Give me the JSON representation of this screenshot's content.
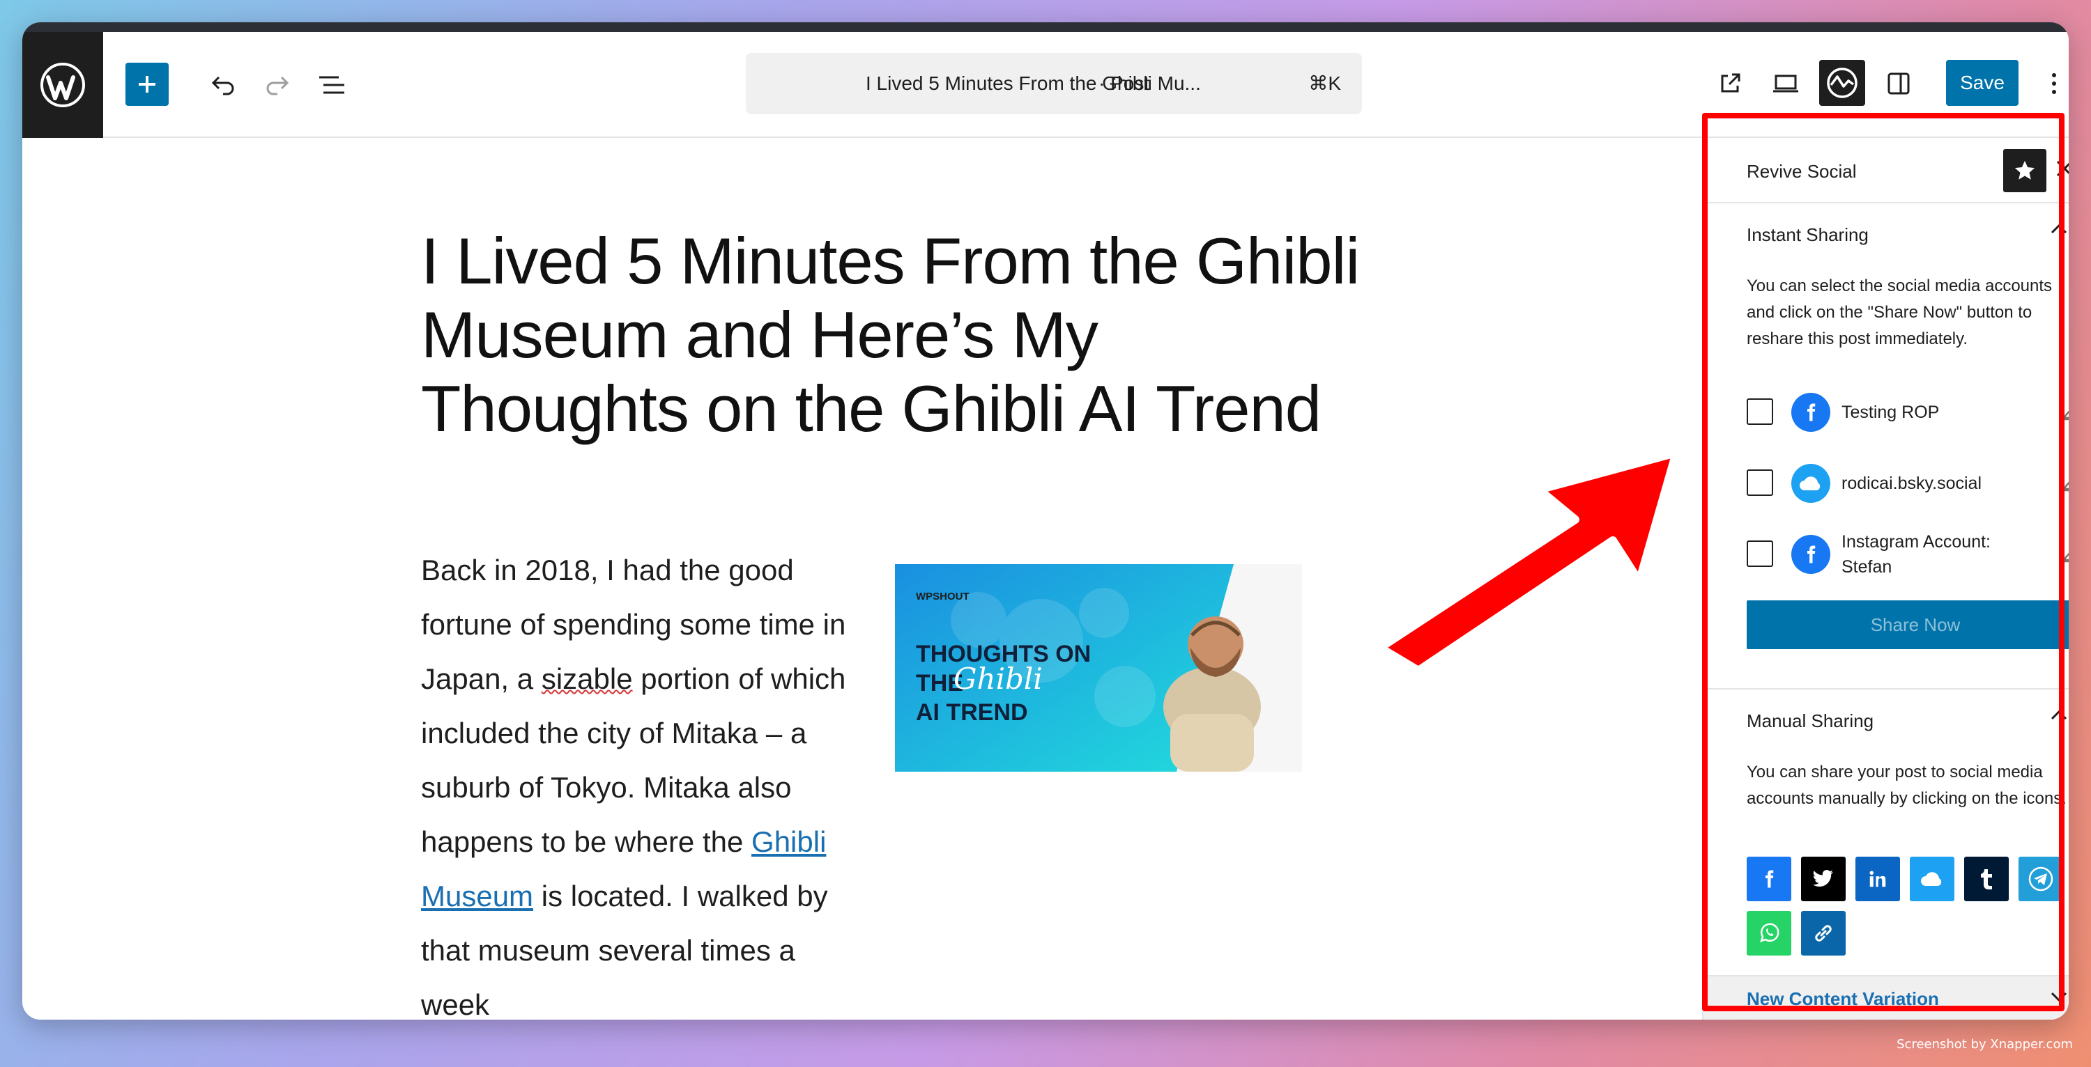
{
  "toolbar": {
    "command_title": "I Lived 5 Minutes From the Ghibli Mu...",
    "command_type": "· Post",
    "command_shortcut": "⌘K",
    "save_label": "Save"
  },
  "post": {
    "title": "I Lived 5 Minutes From the Ghibli Museum and Here’s My Thoughts on the Ghibli AI Trend",
    "body_1": "Back in 2018, I had the good fortune of spending some time in Japan, a ",
    "body_spell": "sizable",
    "body_2": " portion of which included the city of Mitaka – a suburb of Tokyo. Mitaka also happens to be where the ",
    "body_link": "Ghibli Museum",
    "body_3": " is located. I walked by that museum several times a week",
    "image_brand": "WPSHOUT",
    "image_line1": "THOUGHTS ON",
    "image_line2": "THE",
    "image_script": "Ghibli",
    "image_line3": "AI TREND"
  },
  "sidebar": {
    "title": "Revive Social",
    "instant": {
      "title": "Instant Sharing",
      "desc": "You can select the social media accounts and click on the \"Share Now\" button to reshare this post immediately.",
      "accounts": [
        {
          "name": "Testing ROP",
          "network": "facebook"
        },
        {
          "name": "rodicai.bsky.social",
          "network": "bluesky"
        },
        {
          "name": "Instagram Account: Stefan",
          "network": "facebook"
        }
      ],
      "share_label": "Share Now"
    },
    "manual": {
      "title": "Manual Sharing",
      "desc": "You can share your post to social media accounts manually by clicking on the icons.",
      "icons": [
        "facebook-icon",
        "x-twitter-icon",
        "linkedin-icon",
        "bluesky-icon",
        "tumblr-icon",
        "telegram-icon",
        "whatsapp-icon",
        "copy-link-icon"
      ]
    },
    "variation_label": "New Content Variation"
  },
  "colors": {
    "accent": "#0073aa",
    "highlight": "#ff0000",
    "facebook": "#1877f2",
    "bluesky": "#1da1f2",
    "whatsapp": "#25d366"
  },
  "credit": "Screenshot by Xnapper.com"
}
